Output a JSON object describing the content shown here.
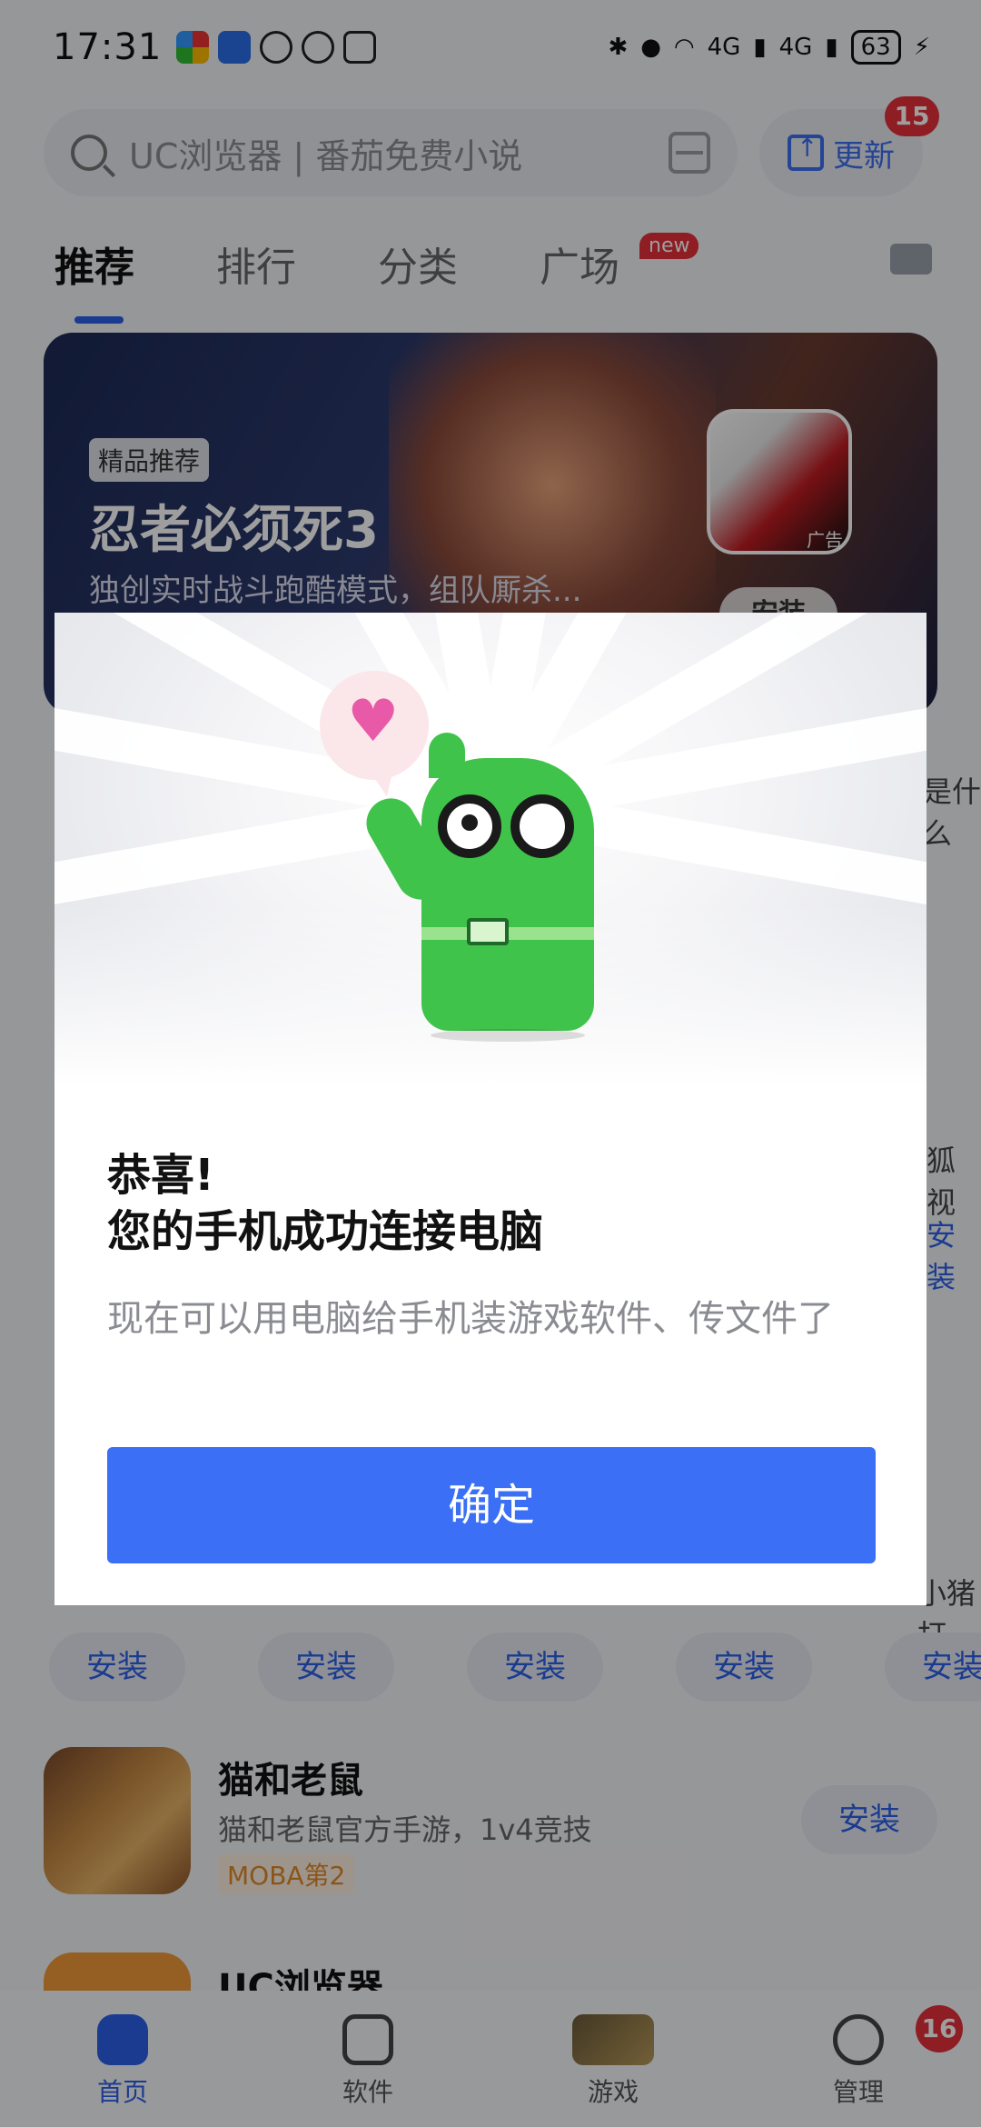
{
  "status_bar": {
    "time": "17:31",
    "network_1": "4G",
    "network_2": "4G",
    "battery": "63"
  },
  "header": {
    "search_placeholder": "UC浏览器 | 番茄免费小说",
    "update_label": "更新",
    "update_badge": "15"
  },
  "tabs": [
    {
      "label": "推荐"
    },
    {
      "label": "排行"
    },
    {
      "label": "分类"
    },
    {
      "label": "广场"
    }
  ],
  "new_badge": "new",
  "banner": {
    "tag": "精品推荐",
    "title": "忍者必须死3",
    "desc": "独创实时战斗跑酷模式，组队厮杀...",
    "ad_label": "广告",
    "install_label": "安装"
  },
  "peek": {
    "text1": "是什么",
    "text2": "狐视",
    "install": "安装",
    "text3": "小猪打"
  },
  "install_row": [
    "安装",
    "安装",
    "安装",
    "安装",
    "安装"
  ],
  "list": [
    {
      "name": "猫和老鼠",
      "desc": "猫和老鼠官方手游，1v4竞技",
      "tag": "MOBA第2",
      "install": "安装"
    },
    {
      "name": "UC浏览器"
    }
  ],
  "bottom_nav": [
    {
      "label": "首页"
    },
    {
      "label": "软件"
    },
    {
      "label": "游戏"
    },
    {
      "label": "管理",
      "badge": "16"
    }
  ],
  "dialog": {
    "title_line1": "恭喜!",
    "title_line2": "您的手机成功连接电脑",
    "message": "现在可以用电脑给手机装游戏软件、传文件了",
    "confirm_label": "确定"
  },
  "colors": {
    "accent": "#3a6ff6",
    "badge": "#e5303a",
    "mascot": "#3fc34a"
  }
}
